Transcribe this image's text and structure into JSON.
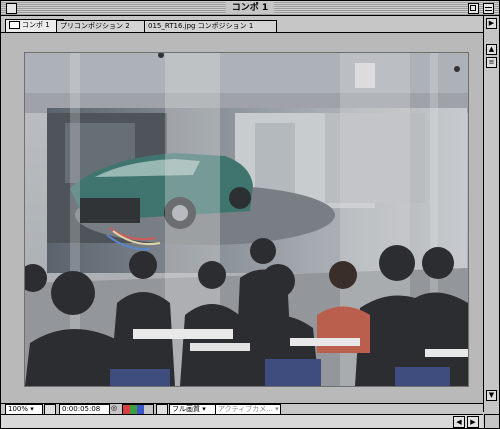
{
  "window": {
    "title": "コンポ 1"
  },
  "tabs": [
    {
      "label": "コンポ 1",
      "active": true
    },
    {
      "label": "プリコンポジション 2",
      "active": false
    },
    {
      "label": "015_RT16.jpg コンポジション 1",
      "active": false
    }
  ],
  "statusbar": {
    "zoom": "100%",
    "timecode": "0:00:05:08",
    "resolution": "フル画質",
    "camera": "アクティブカメ..."
  },
  "icons": {
    "close": "close-box-icon",
    "zoom": "zoom-box-icon",
    "collapse": "collapse-box-icon",
    "comp": "composition-icon",
    "grid": "grid-icon",
    "snapshot": "camera-icon",
    "channels": "color-channels-icon",
    "region": "region-of-interest-icon"
  },
  "colors": {
    "channel_red": "#d54040",
    "channel_green": "#3c9e3c",
    "channel_blue": "#3b56c8"
  }
}
